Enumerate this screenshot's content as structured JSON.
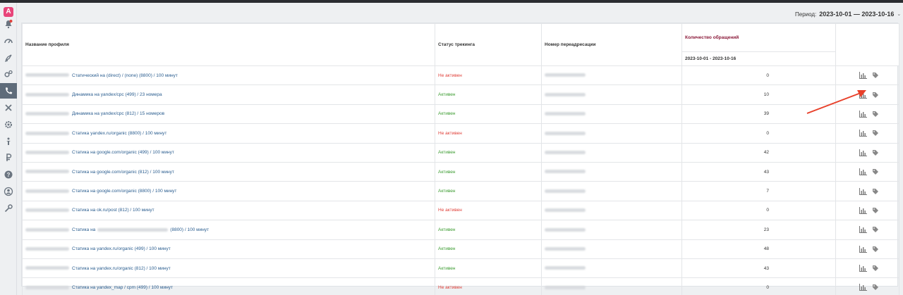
{
  "app": {
    "logo_letter": "A"
  },
  "sidebar": {
    "items": [
      {
        "icon": "bell-icon"
      },
      {
        "icon": "speedometer-icon"
      },
      {
        "icon": "rocket-icon"
      },
      {
        "icon": "gears-icon"
      },
      {
        "icon": "phone-icon",
        "active": true
      },
      {
        "icon": "tools-icon"
      },
      {
        "icon": "settings-icon"
      },
      {
        "icon": "person-icon"
      },
      {
        "icon": "ruble-icon"
      },
      {
        "icon": "help-icon"
      },
      {
        "icon": "user-circle-icon"
      },
      {
        "icon": "key-icon"
      }
    ]
  },
  "period": {
    "label": "Период:",
    "value": "2023-10-01 — 2023-10-16"
  },
  "table": {
    "headers": {
      "profile": "Название профиля",
      "status": "Статус трекинга",
      "redirect": "Номер переадресации",
      "count": "Количество обращений",
      "count_range": "2023-10-01 - 2023-10-16"
    },
    "rows": [
      {
        "profile": "Статический на (direct) / (none) (8800) / 100 минут",
        "status": "Не активен",
        "active": false,
        "count": "0"
      },
      {
        "profile": "Динамика на yandex/cpc (499) / 23 номера",
        "status": "Активен",
        "active": true,
        "count": "10"
      },
      {
        "profile": "Динамика на yandex/cpc (812) / 15 номеров",
        "status": "Активен",
        "active": true,
        "count": "39"
      },
      {
        "profile": "Статика yandex.ru/organic (8800) / 100 минут",
        "status": "Не активен",
        "active": false,
        "count": "0"
      },
      {
        "profile": "Статика на google.com/organic (499) / 100 минут",
        "status": "Активен",
        "active": true,
        "count": "42"
      },
      {
        "profile": "Статика на google.com/organic (812) / 100 минут",
        "status": "Активен",
        "active": true,
        "count": "43"
      },
      {
        "profile": "Статика на google.com/organic (8800) / 100 минут",
        "status": "Активен",
        "active": true,
        "count": "7"
      },
      {
        "profile": "Статика на ok.ru/post (812) / 100 минут",
        "status": "Не активен",
        "active": false,
        "count": "0"
      },
      {
        "profile": "Статика на",
        "profile_tail": "(8800) / 100 минут",
        "status": "Активен",
        "active": true,
        "count": "23"
      },
      {
        "profile": "Статика на yandex.ru/organic (499) / 100 минут",
        "status": "Активен",
        "active": true,
        "count": "48"
      },
      {
        "profile": "Статика на yandex.ru/organic (812) / 100 минут",
        "status": "Активен",
        "active": true,
        "count": "43"
      },
      {
        "profile": "Статика на yandex_map / cpm (499) / 100 минут",
        "status": "Не активен",
        "active": false,
        "count": "0"
      }
    ]
  },
  "colors": {
    "active": "#3a9b2f",
    "inactive": "#e0413a",
    "link": "#2a5d8f",
    "count_header": "#8b1a3a",
    "arrow": "#e8402a"
  }
}
